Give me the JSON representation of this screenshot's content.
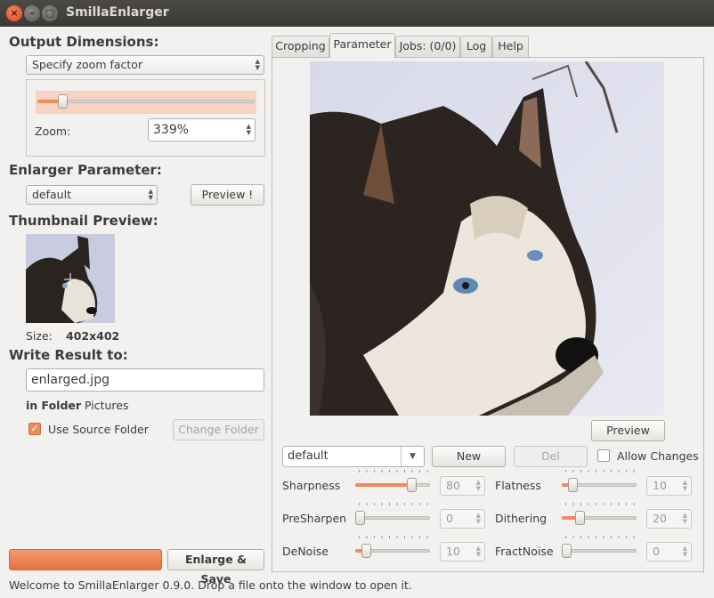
{
  "window": {
    "title": "SmillaEnlarger"
  },
  "left": {
    "output_heading": "Output Dimensions:",
    "output_mode": "Specify zoom factor",
    "zoom_label": "Zoom:",
    "zoom_value": "339%",
    "zoom_slider_level": 0.1,
    "enlarger_heading": "Enlarger Parameter:",
    "enlarger_preset": "default",
    "preview_button": "Preview !",
    "thumb_heading": "Thumbnail Preview:",
    "size_label": "Size:",
    "size_value": "402x402",
    "write_heading": "Write Result to:",
    "filename": "enlarged.jpg",
    "in_folder_label": "in Folder",
    "folder_value": "Pictures",
    "use_source_label": "Use Source Folder",
    "use_source_checked": true,
    "change_folder_button": "Change Folder",
    "enlarge_save_button": "Enlarge & Save"
  },
  "tabs": [
    {
      "label": "Cropping",
      "active": false
    },
    {
      "label": "Parameter",
      "active": true
    },
    {
      "label": "Jobs: (0/0)",
      "active": false
    },
    {
      "label": "Log",
      "active": false
    },
    {
      "label": "Help",
      "active": false
    }
  ],
  "parameter": {
    "preview_button": "Preview",
    "preset": "default",
    "new_button": "New",
    "del_button": "Del",
    "allow_changes_label": "Allow Changes",
    "allow_changes_checked": false,
    "params_left": [
      {
        "label": "Sharpness",
        "value": "80",
        "level": 0.8
      },
      {
        "label": "PreSharpen",
        "value": "0",
        "level": 0.0
      },
      {
        "label": "DeNoise",
        "value": "10",
        "level": 0.1
      }
    ],
    "params_right": [
      {
        "label": "Flatness",
        "value": "10",
        "level": 0.1
      },
      {
        "label": "Dithering",
        "value": "20",
        "level": 0.2
      },
      {
        "label": "FractNoise",
        "value": "0",
        "level": 0.0
      }
    ]
  },
  "status": "Welcome to SmillaEnlarger 0.9.0.  Drop a file onto the window to open it.",
  "colors": {
    "accent": "#f08a5d",
    "titlebar": "#3c3b37"
  }
}
